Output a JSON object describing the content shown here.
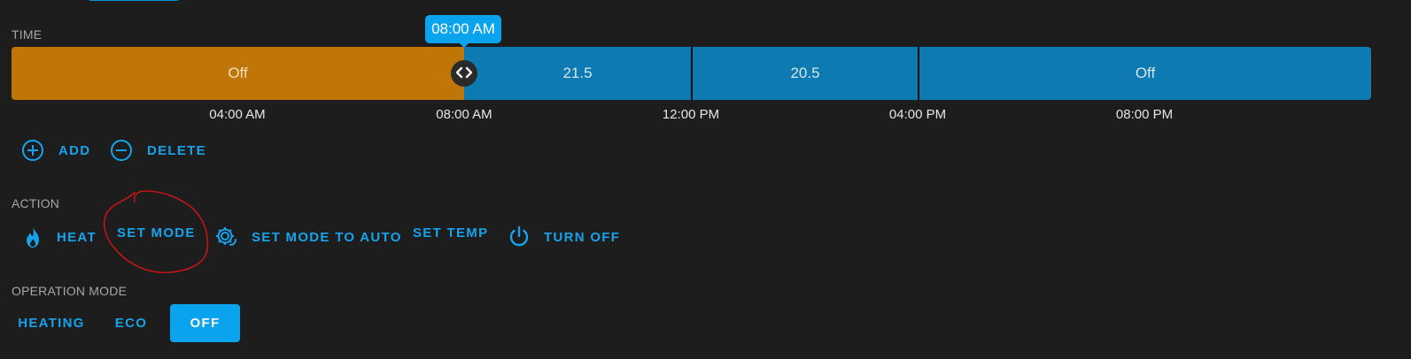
{
  "colors": {
    "background": "#1d1d1d",
    "accent": "#0aa4ee",
    "slot_off_active": "#c07606",
    "slot_blue": "#0d7bb1",
    "annotation": "#c0141a"
  },
  "time_section": {
    "label": "TIME",
    "tooltip": "08:00 AM",
    "slots": [
      "Off",
      "21.5",
      "20.5",
      "Off"
    ],
    "ticks": [
      "04:00 AM",
      "08:00 AM",
      "12:00 PM",
      "04:00 PM",
      "08:00 PM"
    ],
    "handle_icon": "code-arrows-icon"
  },
  "edit_actions": {
    "add_label": "ADD",
    "add_icon": "plus-circle-icon",
    "delete_label": "DELETE",
    "delete_icon": "minus-circle-icon"
  },
  "action_section": {
    "label": "ACTION",
    "items": [
      {
        "label": "HEAT",
        "icon": "fire-icon"
      },
      {
        "label": "SET MODE",
        "icon": ""
      },
      {
        "label": "SET MODE TO AUTO",
        "icon": "gear-sync-icon"
      },
      {
        "label": "SET TEMP",
        "icon": ""
      },
      {
        "label": "TURN OFF",
        "icon": "power-icon"
      }
    ]
  },
  "operation_mode": {
    "label": "OPERATION MODE",
    "options": [
      "HEATING",
      "ECO",
      "OFF"
    ],
    "selected": "OFF"
  }
}
